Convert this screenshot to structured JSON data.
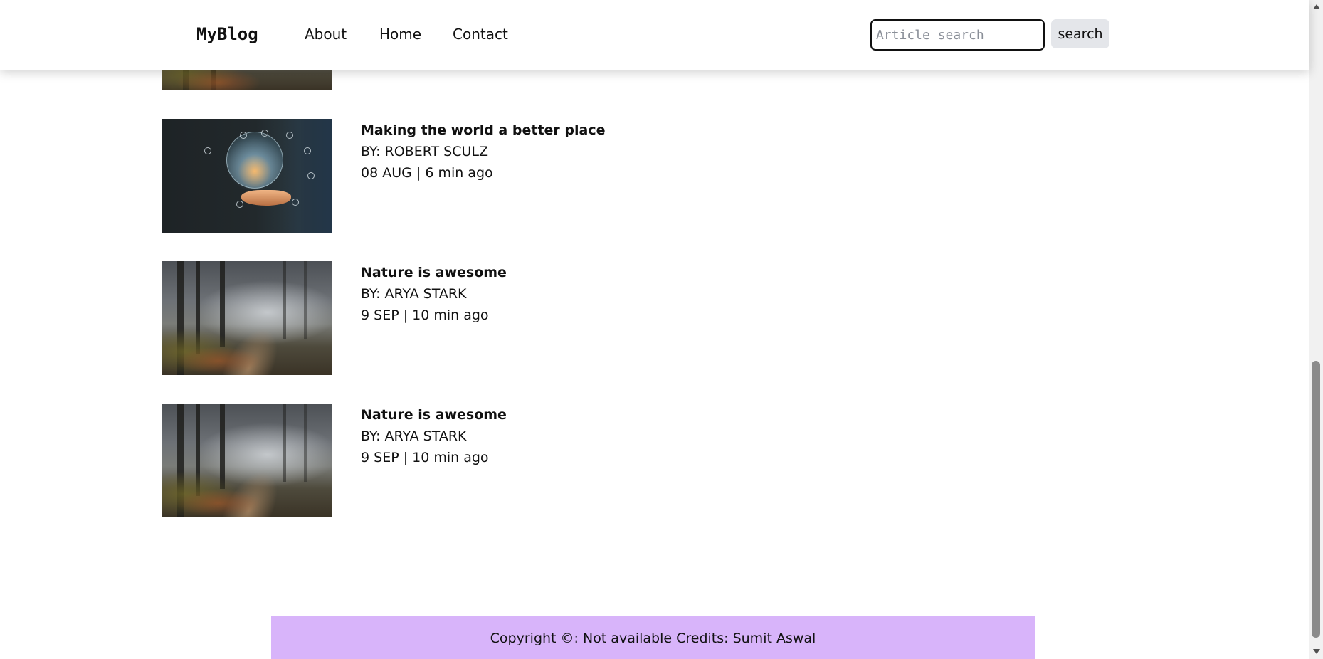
{
  "navbar": {
    "brand": "MyBlog",
    "links": [
      {
        "label": "About"
      },
      {
        "label": "Home"
      },
      {
        "label": "Contact"
      }
    ],
    "search": {
      "placeholder": "Article search",
      "value": "",
      "button_label": "search"
    }
  },
  "articles": [
    {
      "title": "Making the world a better place",
      "author": "BY: ROBERT SCULZ",
      "date": "08 AUG | 6 min ago",
      "image": "world-hand-globe-image"
    },
    {
      "title": "Nature is awesome",
      "author": "BY: ARYA STARK",
      "date": "9 SEP | 10 min ago",
      "image": "foggy-forest-image"
    },
    {
      "title": "Nature is awesome",
      "author": "BY: ARYA STARK",
      "date": "9 SEP | 10 min ago",
      "image": "foggy-forest-image"
    }
  ],
  "footer": {
    "text": "Copyright ©: Not available Credits: Sumit Aswal"
  },
  "colors": {
    "footer_bg": "#d8b4fa",
    "search_button_bg": "#e4e6ea"
  }
}
